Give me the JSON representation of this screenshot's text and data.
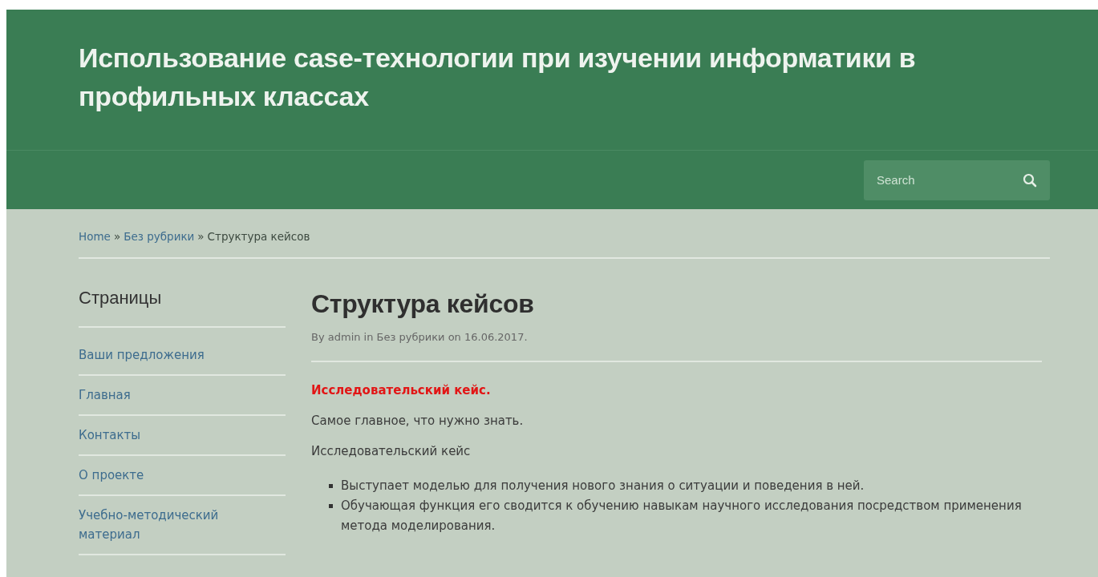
{
  "header": {
    "site_title": "Использование case-технологии при изучении информатики в профильных классах",
    "search": {
      "placeholder": "Search"
    }
  },
  "breadcrumb": [
    {
      "text": "Home",
      "kind": "link"
    },
    {
      "text": "»",
      "kind": "separator"
    },
    {
      "text": "Без рубрики",
      "kind": "link"
    },
    {
      "text": "»",
      "kind": "separator"
    },
    {
      "text": "Структура кейсов",
      "kind": "current"
    }
  ],
  "sidebar": {
    "title": "Страницы",
    "items": [
      "Ваши предложения",
      "Главная",
      "Контакты",
      "О проекте",
      "Учебно-методический материал"
    ]
  },
  "article": {
    "title": "Структура кейсов",
    "meta": "By admin in Без рубрики on 16.06.2017.",
    "blocks": [
      {
        "kind": "heading",
        "text": "Исследовательский кейс."
      },
      {
        "kind": "paragraph",
        "text": "Самое главное, что нужно знать."
      },
      {
        "kind": "paragraph",
        "text": "Исследовательский кейс"
      },
      {
        "kind": "list",
        "items": [
          "Выступает моделью для получения нового знания о ситуации и поведения в ней.",
          "Обучающая функция его сводится к обучению навыкам научного исследования посредством применения метода моделирования."
        ]
      }
    ]
  }
}
